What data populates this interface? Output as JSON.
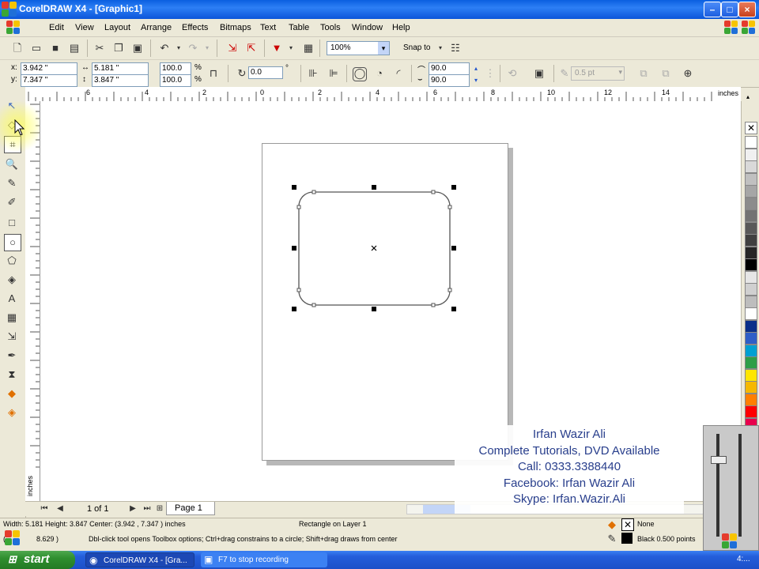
{
  "window": {
    "title": "CorelDRAW X4 - [Graphic1]"
  },
  "menu": [
    "Edit",
    "View",
    "Layout",
    "Arrange",
    "Effects",
    "Bitmaps",
    "Text",
    "Table",
    "Tools",
    "Window",
    "Help"
  ],
  "toolbar": {
    "zoom": "100%",
    "snap_to": "Snap to"
  },
  "property_bar": {
    "x_label": "x:",
    "x_value": "3.942 \"",
    "y_label": "y:",
    "y_value": "7.347 \"",
    "width_value": "5.181 \"",
    "height_value": "3.847 \"",
    "scale_x": "100.0",
    "scale_y": "100.0",
    "percent": "%",
    "rotation": "0.0",
    "degree": "°",
    "corner_top": "90.0",
    "corner_bottom": "90.0",
    "outline_width": "0.5 pt"
  },
  "ruler": {
    "units": "inches",
    "h_labels": [
      "6",
      "4",
      "2",
      "0",
      "2",
      "4",
      "6",
      "8",
      "10",
      "12",
      "14"
    ],
    "v_units": "inches"
  },
  "page_nav": {
    "counter": "1 of 1",
    "tab": "Page 1"
  },
  "status": {
    "line1_left": "Width: 5.181  Height: 3.847  Center: (3.942 , 7.347 )  inches",
    "line1_mid": "Rectangle on Layer 1",
    "line2_left_a": "( -",
    "line2_left_b": "8.629 )",
    "line2_mid": "Dbl-click tool opens Toolbox options; Ctrl+drag constrains to a circle; Shift+drag draws from center",
    "fill_label": "None",
    "outline_label": "Black  0.500 points"
  },
  "taskbar": {
    "start": "start",
    "items": [
      "CorelDRAW X4 - [Gra...",
      "F7 to stop recording"
    ],
    "clock": "4:..."
  },
  "overlay": {
    "lines": [
      "Irfan Wazir Ali",
      "Complete Tutorials, DVD Available",
      "Call: 0333.3388440",
      "Facebook: Irfan Wazir Ali",
      "Skype: Irfan.Wazir.Ali"
    ]
  },
  "palette_colors": [
    "#ffffff",
    "#f0f0f0",
    "#d9d9d9",
    "#c0c0c0",
    "#a6a6a6",
    "#8c8c8c",
    "#737373",
    "#595959",
    "#404040",
    "#262626",
    "#000000",
    "#e6e6e6",
    "#d0d0d0",
    "#bdbdbd",
    "#ffffff",
    "#0a2f8a",
    "#2f5ec7",
    "#00a0d2",
    "#2e9e47",
    "#ffe600",
    "#f5b800",
    "#ff7f00",
    "#ff0000",
    "#e8004c",
    "#c71585",
    "#ff77a8",
    "#ff8a33",
    "#c97a45",
    "#9e8fe0",
    "#6a4fb5"
  ]
}
